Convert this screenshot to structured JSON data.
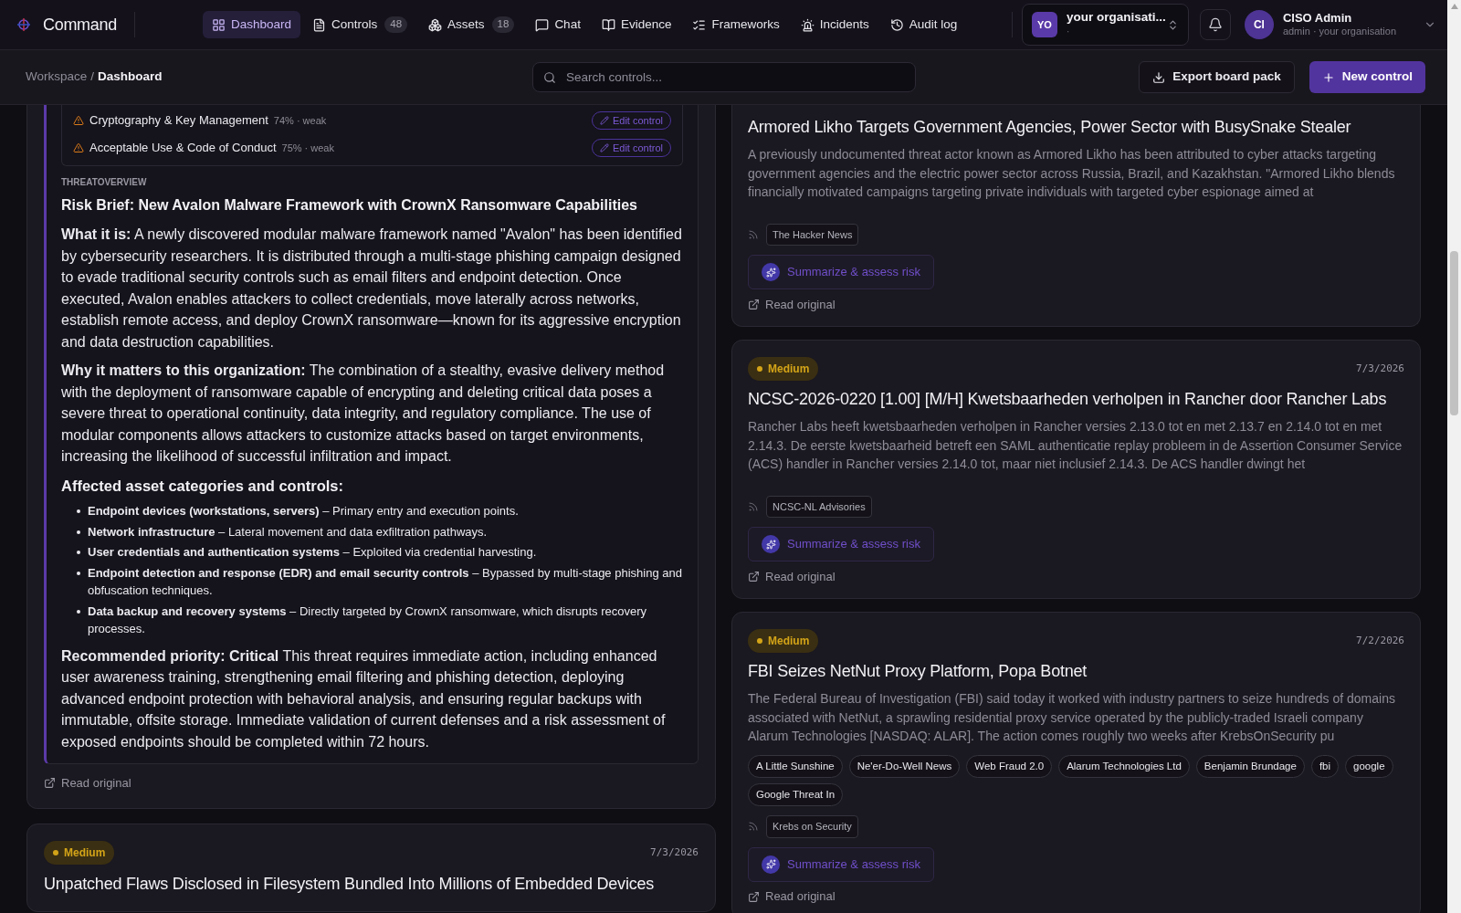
{
  "app": {
    "name": "Command"
  },
  "nav": [
    {
      "label": "Dashboard",
      "selected": true
    },
    {
      "label": "Controls",
      "count": "48",
      "selected": false
    },
    {
      "label": "Assets",
      "count": "18",
      "selected": false
    },
    {
      "label": "Chat",
      "selected": false
    },
    {
      "label": "Evidence",
      "selected": false
    },
    {
      "label": "Frameworks",
      "selected": false
    },
    {
      "label": "Incidents",
      "selected": false
    },
    {
      "label": "Audit log",
      "selected": false
    }
  ],
  "org": {
    "initials": "YO",
    "name": "your organisati...",
    "subtitle": "·"
  },
  "user": {
    "initials": "CI",
    "name": "CISO Admin",
    "subtitle": "admin · your organisation"
  },
  "breadcrumb": {
    "parent": "Workspace",
    "separator": "/",
    "current": "Dashboard"
  },
  "search": {
    "placeholder": "Search controls..."
  },
  "actions": [
    {
      "label": "Export board pack",
      "kind": "secondary"
    },
    {
      "label": "New control",
      "kind": "primary"
    }
  ],
  "left_feed": [
    {
      "kind": "analyzed",
      "controls": [
        {
          "name": "Cryptography & Key Management",
          "score": "74% · weak",
          "action": "Edit control"
        },
        {
          "name": "Acceptable Use & Code of Conduct",
          "score": "75% · weak",
          "action": "Edit control"
        }
      ],
      "section_label": "THREATOVERVIEW",
      "title": "Risk Brief: New Avalon Malware Framework with CrownX Ransomware Capabilities",
      "paragraphs": [
        "**What it is:** A newly discovered modular malware framework named \"Avalon\" has been identified by cybersecurity researchers. It is distributed through a multi-stage phishing campaign designed to evade traditional security controls such as email filters and endpoint detection. Once executed, Avalon enables attackers to collect credentials, move laterally across networks, establish remote access, and deploy CrownX ransomware—known for its aggressive encryption and data destruction capabilities.",
        "**Why it matters to this organization:** The combination of a stealthy, evasive delivery method with the deployment of ransomware capable of encrypting and deleting critical data poses a severe threat to operational continuity, data integrity, and regulatory compliance. The use of modular components allows attackers to customize attacks based on target environments, increasing the likelihood of successful infiltration and impact."
      ],
      "list_heading": "Affected asset categories and controls:",
      "list": [
        "**Endpoint devices (workstations, servers)** – Primary entry and execution points.",
        "**Network infrastructure** – Lateral movement and data exfiltration pathways.",
        "**User credentials and authentication systems** – Exploited via credential harvesting.",
        "**Endpoint detection and response (EDR) and email security controls** – Bypassed by multi-stage phishing and obfuscation techniques.",
        "**Data backup and recovery systems** – Directly targeted by CrownX ransomware, which disrupts recovery processes."
      ],
      "recommendation": "**Recommended priority: Critical** This threat requires immediate action, including enhanced user awareness training, strengthening email filtering and phishing detection, deploying advanced endpoint protection with behavioral analysis, and ensuring regular backups with immutable, offsite storage. Immediate validation of current defenses and a risk assessment of exposed endpoints should be completed within 72 hours.",
      "link": "Read original"
    },
    {
      "kind": "article",
      "severity": "Medium",
      "date": "7/3/2026",
      "title": "Unpatched Flaws Disclosed in Filesystem Bundled Into Millions of Embedded Devices"
    }
  ],
  "right_feed": [
    {
      "title": "Armored Likho Targets Government Agencies, Power Sector with BusySnake Stealer",
      "summary": "A previously undocumented threat actor known as Armored Likho has been attributed to cyber attacks targeting government agencies and the electric power sector across Russia, Brazil, and Kazakhstan. \"Armored Likho blends financially motivated campaigns targeting private individuals with targeted cyber espionage aimed at",
      "source": "The Hacker News",
      "button": "Summarize & assess risk",
      "link": "Read original"
    },
    {
      "severity": "Medium",
      "date": "7/3/2026",
      "title": "NCSC-2026-0220 [1.00] [M/H] Kwetsbaarheden verholpen in Rancher door Rancher Labs",
      "summary": "Rancher Labs heeft kwetsbaarheden verholpen in Rancher versies 2.13.0 tot en met 2.13.7 en 2.14.0 tot en met 2.14.3. De eerste kwetsbaarheid betreft een SAML authenticatie replay probleem in de Assertion Consumer Service (ACS) handler in Rancher versies 2.14.0 tot, maar niet inclusief 2.14.3. De ACS handler dwingt het",
      "source": "NCSC-NL Advisories",
      "button": "Summarize & assess risk",
      "link": "Read original"
    },
    {
      "severity": "Medium",
      "date": "7/2/2026",
      "title": "FBI Seizes NetNut Proxy Platform, Popa Botnet",
      "summary": "The Federal Bureau of Investigation (FBI) said today it worked with industry partners to seize hundreds of domains associated with NetNut, a sprawling residential proxy service operated by the publicly-traded Israeli company Alarum Technologies [NASDAQ: ALAR]. The action comes roughly two weeks after KrebsOnSecurity pu",
      "tags": [
        "A Little Sunshine",
        "Ne'er-Do-Well News",
        "Web Fraud 2.0",
        "Alarum Technologies Ltd",
        "Benjamin Brundage",
        "fbi",
        "google",
        "Google Threat In"
      ],
      "source": "Krebs on Security",
      "button": "Summarize & assess risk",
      "link": "Read original"
    }
  ]
}
